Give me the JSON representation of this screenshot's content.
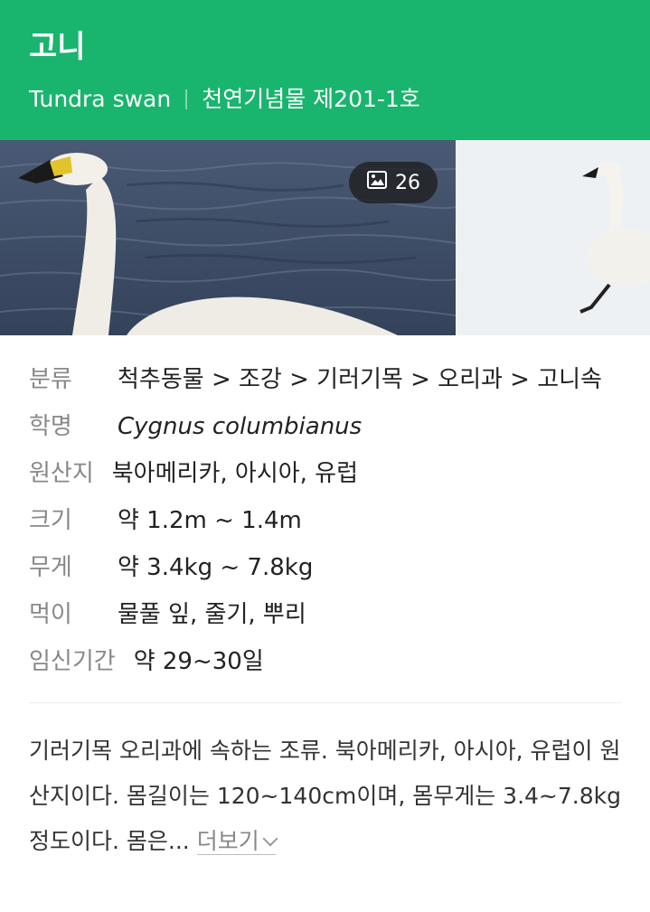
{
  "header": {
    "title": "고니",
    "english_name": "Tundra swan",
    "designation": "천연기념물 제201-1호"
  },
  "gallery": {
    "photo_count": "26",
    "count_icon": "image-icon"
  },
  "info": {
    "rows": [
      {
        "label": "분류",
        "value": "척추동물 > 조강 > 기러기목 > 오리과 > 고니속"
      },
      {
        "label": "학명",
        "value": "Cygnus columbianus"
      },
      {
        "label": "원산지",
        "value": "북아메리카, 아시아, 유럽"
      },
      {
        "label": "크기",
        "value": "약 1.2m ~ 1.4m"
      },
      {
        "label": "무게",
        "value": "약 3.4kg ~ 7.8kg"
      },
      {
        "label": "먹이",
        "value": "물풀 잎, 줄기, 뿌리"
      },
      {
        "label": "임신기간",
        "value": "약 29~30일"
      }
    ]
  },
  "description": {
    "text": "기러기목 오리과에 속하는 조류. 북아메리카, 아시아, 유럽이 원산지이다. 몸길이는 120~140cm이며, 몸무게는 3.4~7.8kg 정도이다. 몸은...",
    "more_label": "더보기"
  },
  "colors": {
    "header_bg": "#19b46e",
    "label": "#888888"
  }
}
